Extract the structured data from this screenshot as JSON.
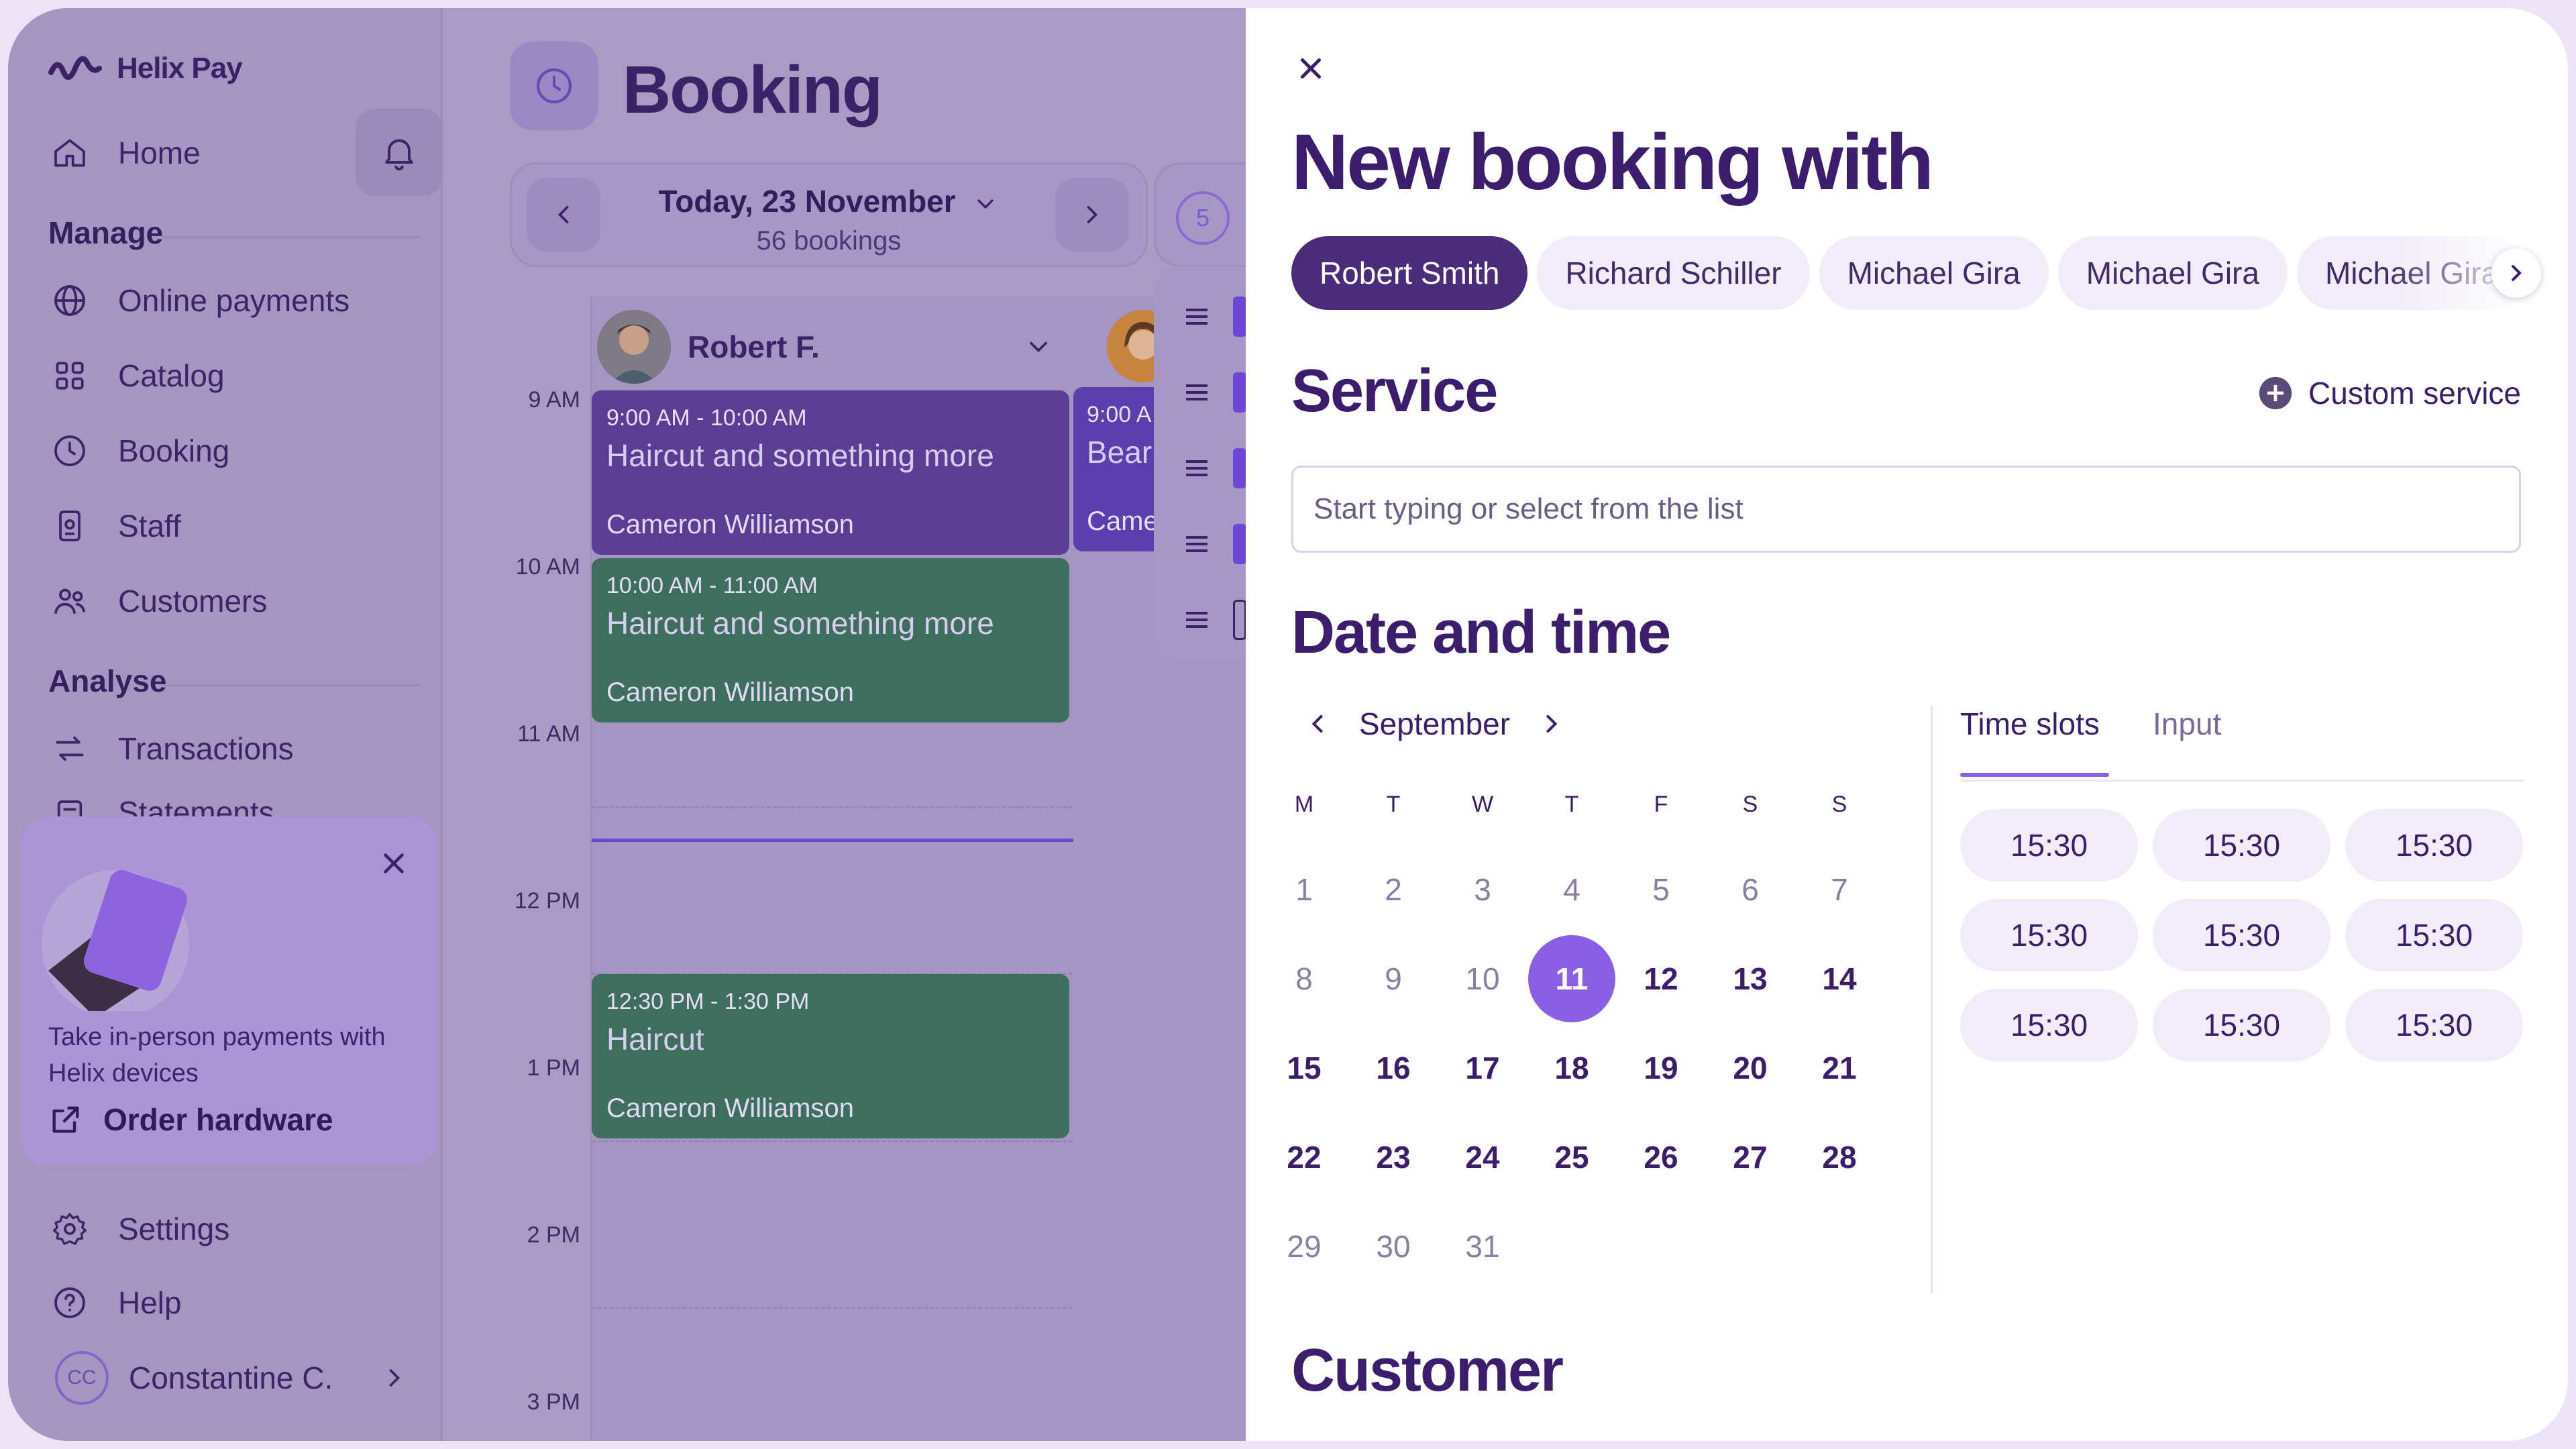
{
  "app": {
    "brand": "Helix Pay",
    "colors": {
      "accent": "#8a5fe6",
      "brand_dark": "#3b1c6d",
      "event_purple": "#5b3e93",
      "event_green": "#3d6e5e",
      "overlay": "#a99bc4"
    }
  },
  "sidebar": {
    "home": "Home",
    "sections": {
      "manage": "Manage",
      "analyse": "Analyse"
    },
    "manage_items": [
      {
        "label": "Online payments",
        "icon": "globe-icon"
      },
      {
        "label": "Catalog",
        "icon": "grid-icon"
      },
      {
        "label": "Booking",
        "icon": "clock-icon"
      },
      {
        "label": "Staff",
        "icon": "badge-icon"
      },
      {
        "label": "Customers",
        "icon": "users-icon"
      }
    ],
    "analyse_items": [
      {
        "label": "Transactions",
        "icon": "transfer-icon"
      },
      {
        "label": "Statements",
        "icon": "document-icon"
      }
    ],
    "promo": {
      "text": "Take in-person payments with Helix devices",
      "link": "Order hardware"
    },
    "settings": "Settings",
    "help": "Help",
    "user": {
      "initials": "CC",
      "name": "Constantine C."
    }
  },
  "booking": {
    "title": "Booking",
    "date_label": "Today, 23 November",
    "bookings_count": "56 bookings",
    "staff_count": "5",
    "staff_name": "Robert F.",
    "time_labels": [
      "9 AM",
      "10 AM",
      "11 AM",
      "12 PM",
      "1 PM",
      "2 PM",
      "3 PM"
    ],
    "events": [
      {
        "time": "9:00 AM - 10:00 AM",
        "service": "Haircut and something more",
        "customer": "Cameron Williamson"
      },
      {
        "time": "10:00 AM - 11:00 AM",
        "service": "Haircut and something more",
        "customer": "Cameron Williamson"
      },
      {
        "time": "12:30 PM - 1:30 PM",
        "service": "Haircut",
        "customer": "Cameron Williamson"
      }
    ],
    "second_event": {
      "time": "9:00 A",
      "service": "Bear",
      "customer": "Came"
    }
  },
  "modal": {
    "title": "New booking with",
    "staff_chips": [
      "Robert Smith",
      "Richard Schiller",
      "Michael Gira",
      "Michael Gira",
      "Michael Gira"
    ],
    "service": {
      "title": "Service",
      "custom_label": "Custom service",
      "placeholder": "Start typing or select from the list"
    },
    "date_time": {
      "title": "Date and time",
      "month": "September",
      "weekdays": [
        "M",
        "T",
        "W",
        "T",
        "F",
        "S",
        "S"
      ],
      "days": [
        "1",
        "2",
        "3",
        "4",
        "5",
        "6",
        "7",
        "8",
        "9",
        "10",
        "11",
        "12",
        "13",
        "14",
        "15",
        "16",
        "17",
        "18",
        "19",
        "20",
        "21",
        "22",
        "23",
        "24",
        "25",
        "26",
        "27",
        "28",
        "29",
        "30",
        "31"
      ],
      "selected_day": "11",
      "tabs": [
        "Time slots",
        "Input"
      ],
      "slots": [
        "15:30",
        "15:30",
        "15:30",
        "15:30",
        "15:30",
        "15:30",
        "15:30",
        "15:30",
        "15:30"
      ]
    },
    "customer_title": "Customer"
  }
}
